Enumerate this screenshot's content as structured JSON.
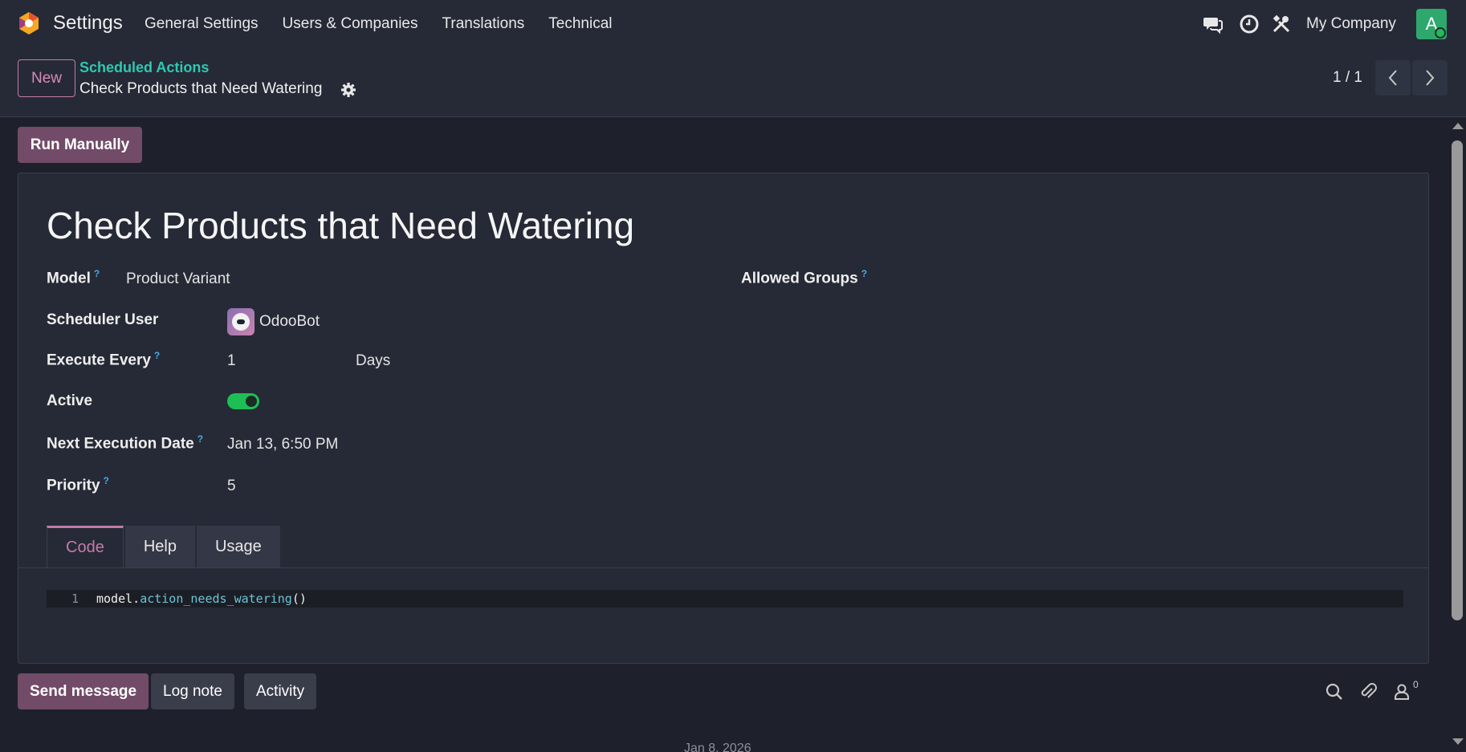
{
  "navbar": {
    "app_title": "Settings",
    "menu": [
      "General Settings",
      "Users & Companies",
      "Translations",
      "Technical"
    ],
    "company": "My Company",
    "avatar_letter": "A"
  },
  "control": {
    "new_label": "New",
    "breadcrumb_parent": "Scheduled Actions",
    "breadcrumb_current": "Check Products that Need Watering",
    "pager": "1 / 1"
  },
  "actions": {
    "run_manually": "Run Manually"
  },
  "form": {
    "title": "Check Products that Need Watering",
    "help_mark": "?",
    "fields": {
      "model_label": "Model",
      "model_value": "Product Variant",
      "scheduler_user_label": "Scheduler User",
      "scheduler_user_value": "OdooBot",
      "execute_every_label": "Execute Every",
      "execute_every_value": "1",
      "execute_every_unit": "Days",
      "active_label": "Active",
      "active_value": true,
      "next_execution_label": "Next Execution Date",
      "next_execution_value": "Jan 13, 6:50 PM",
      "priority_label": "Priority",
      "priority_value": "5",
      "allowed_groups_label": "Allowed Groups"
    },
    "tabs": [
      "Code",
      "Help",
      "Usage"
    ],
    "active_tab": "Code",
    "code": {
      "line_number": "1",
      "object": "model",
      "dot": ".",
      "method": "action_needs_watering",
      "parens": "()"
    }
  },
  "chatter": {
    "send_message": "Send message",
    "log_note": "Log note",
    "activity": "Activity",
    "followers_count": "0",
    "date_separator": "Jan 8, 2026"
  },
  "colors": {
    "accent": "#714b67",
    "teal_link": "#2ec8b4",
    "toggle_on": "#1dbf55",
    "background": "#1e212b"
  },
  "icons": [
    "chat-icon",
    "clock-icon",
    "tools-icon",
    "gear-icon",
    "chevron-left-icon",
    "chevron-right-icon",
    "search-icon",
    "paperclip-icon",
    "follower-icon"
  ]
}
